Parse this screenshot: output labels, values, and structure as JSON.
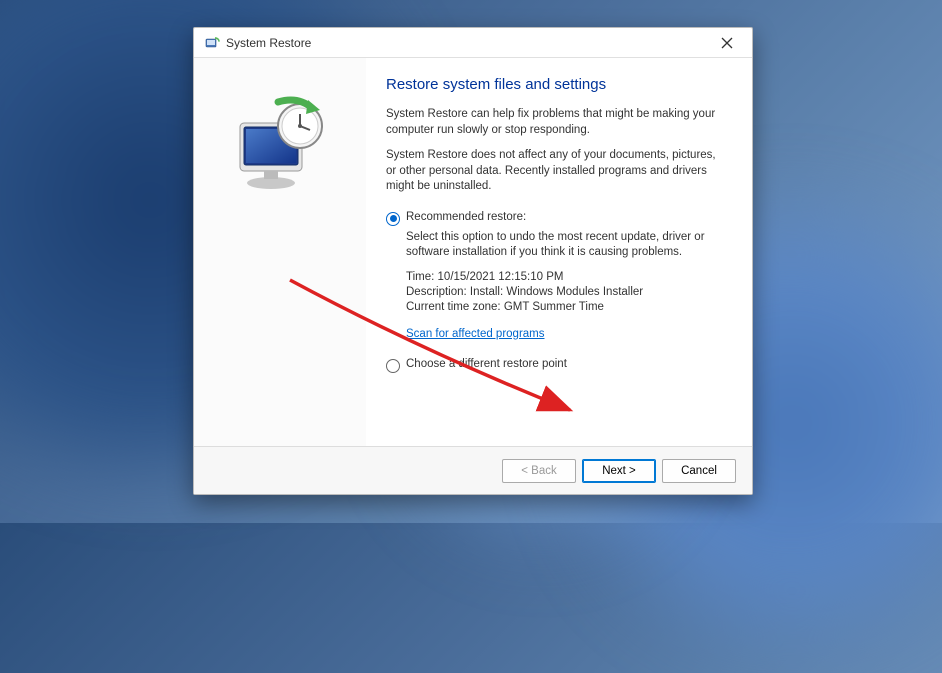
{
  "window": {
    "title": "System Restore"
  },
  "heading": "Restore system files and settings",
  "intro1": "System Restore can help fix problems that might be making your computer run slowly or stop responding.",
  "intro2": "System Restore does not affect any of your documents, pictures, or other personal data. Recently installed programs and drivers might be uninstalled.",
  "radio": {
    "recommended": {
      "label": "Recommended restore:",
      "desc": "Select this option to undo the most recent update, driver or software installation if you think it is causing problems.",
      "time_label": "Time:",
      "time_value": "10/15/2021 12:15:10 PM",
      "desc_label": "Description:",
      "desc_value": "Install: Windows Modules Installer",
      "tz_label": "Current time zone:",
      "tz_value": "GMT Summer Time"
    },
    "different": {
      "label": "Choose a different restore point"
    }
  },
  "link": "Scan for affected programs",
  "buttons": {
    "back": "< Back",
    "next": "Next >",
    "cancel": "Cancel"
  }
}
